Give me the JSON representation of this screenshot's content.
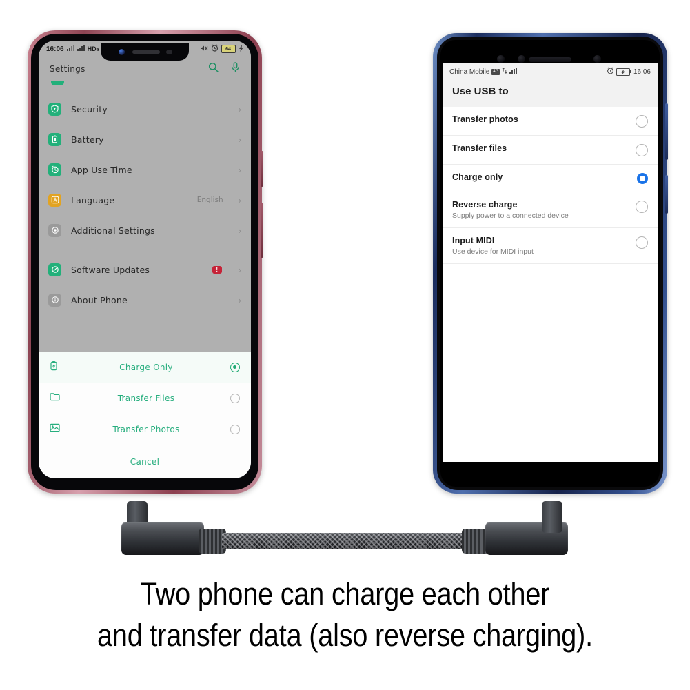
{
  "scene": {
    "caption_line1": "Two phone can charge each other",
    "caption_line2": "and transfer data (also reverse charging).",
    "cable_name": "usb-c-to-usb-c-braided-right-angle-cable",
    "accent_green": "#27ae7e",
    "accent_blue": "#1a73e8",
    "left_frame_color": "#8d4453",
    "right_frame_color": "#1b2d5e"
  },
  "left_phone": {
    "status_bar": {
      "time": "16:06",
      "network_label": "HD",
      "network_sub": "a",
      "signal_icon": "signal-bars-icon",
      "signal_icon_2": "signal-bars-icon",
      "mute_icon": "vibrate-mute-icon",
      "alarm_icon": "alarm-clock-icon",
      "battery_level": "64",
      "charge_icon": "charging-bolt-icon"
    },
    "app_bar": {
      "title": "Settings",
      "search_icon": "search-icon",
      "mic_icon": "microphone-icon"
    },
    "settings_items": [
      {
        "label": "Security",
        "icon": "shield-icon",
        "icon_bg": "#22b07a",
        "value": "",
        "badge": ""
      },
      {
        "label": "Battery",
        "icon": "battery-icon",
        "icon_bg": "#22b07a",
        "value": "",
        "badge": ""
      },
      {
        "label": "App Use Time",
        "icon": "clock-icon",
        "icon_bg": "#22b07a",
        "value": "",
        "badge": ""
      },
      {
        "label": "Language",
        "icon": "letter-a-icon",
        "icon_bg": "#e2a321",
        "value": "English",
        "badge": ""
      },
      {
        "label": "Additional Settings",
        "icon": "dot-disc-icon",
        "icon_bg": "#9a9a9a",
        "value": "",
        "badge": ""
      }
    ],
    "settings_items_2": [
      {
        "label": "Software Updates",
        "icon": "refresh-icon",
        "icon_bg": "#22b07a",
        "value": "",
        "badge": "!"
      },
      {
        "label": "About Phone",
        "icon": "info-icon",
        "icon_bg": "#9a9a9a",
        "value": "",
        "badge": ""
      }
    ],
    "usb_sheet": {
      "options": [
        {
          "label": "Charge Only",
          "icon": "battery-charge-icon",
          "selected": true
        },
        {
          "label": "Transfer Files",
          "icon": "folder-icon",
          "selected": false
        },
        {
          "label": "Transfer Photos",
          "icon": "photo-icon",
          "selected": false
        }
      ],
      "cancel_label": "Cancel"
    }
  },
  "right_phone": {
    "status_bar": {
      "carrier": "China Mobile",
      "badge_4g": "4G",
      "data_icon": "data-transfer-icon",
      "signal_icon": "signal-bars-icon",
      "alarm_icon": "alarm-clock-icon",
      "battery_icon": "battery-charging-icon",
      "time": "16:06"
    },
    "header_title": "Use USB to",
    "options": [
      {
        "label": "Transfer photos",
        "subtitle": "",
        "selected": false
      },
      {
        "label": "Transfer files",
        "subtitle": "",
        "selected": false
      },
      {
        "label": "Charge only",
        "subtitle": "",
        "selected": true
      },
      {
        "label": "Reverse charge",
        "subtitle": "Supply power to a connected device",
        "selected": false
      },
      {
        "label": "Input MIDI",
        "subtitle": "Use device for MIDI input",
        "selected": false
      }
    ]
  }
}
